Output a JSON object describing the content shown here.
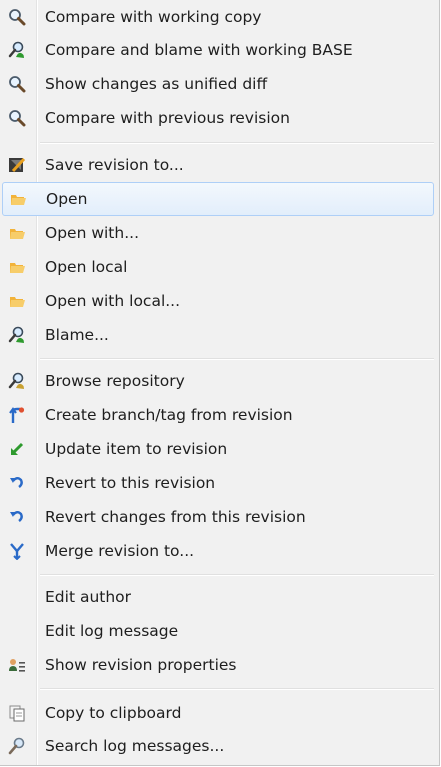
{
  "menu": {
    "items": [
      {
        "label": "Compare with working copy",
        "icon": "magnifier-icon"
      },
      {
        "label": "Compare and blame with working BASE",
        "icon": "blame-icon"
      },
      {
        "label": "Show changes as unified diff",
        "icon": "magnifier-icon"
      },
      {
        "label": "Compare with previous revision",
        "icon": "magnifier-icon"
      },
      {
        "label": "Save revision to...",
        "icon": "save-icon"
      },
      {
        "label": "Open",
        "icon": "open-icon",
        "highlighted": true
      },
      {
        "label": "Open with...",
        "icon": "open-icon"
      },
      {
        "label": "Open local",
        "icon": "open-icon"
      },
      {
        "label": "Open with local...",
        "icon": "open-icon"
      },
      {
        "label": "Blame...",
        "icon": "blame-icon"
      },
      {
        "label": "Browse repository",
        "icon": "browse-icon"
      },
      {
        "label": "Create branch/tag from revision",
        "icon": "branch-icon"
      },
      {
        "label": "Update item to revision",
        "icon": "update-icon"
      },
      {
        "label": "Revert to this revision",
        "icon": "revert-icon"
      },
      {
        "label": "Revert changes from this revision",
        "icon": "revert-icon"
      },
      {
        "label": "Merge revision to...",
        "icon": "merge-icon"
      },
      {
        "label": "Edit author",
        "icon": ""
      },
      {
        "label": "Edit log message",
        "icon": ""
      },
      {
        "label": "Show revision properties",
        "icon": "properties-icon"
      },
      {
        "label": "Copy to clipboard",
        "icon": "clipboard-icon"
      },
      {
        "label": "Search log messages...",
        "icon": "search-icon"
      }
    ]
  },
  "colors": {
    "menu_background": "#f1f1f1",
    "highlight_border": "#aecff7",
    "text": "#1e1e1e"
  }
}
